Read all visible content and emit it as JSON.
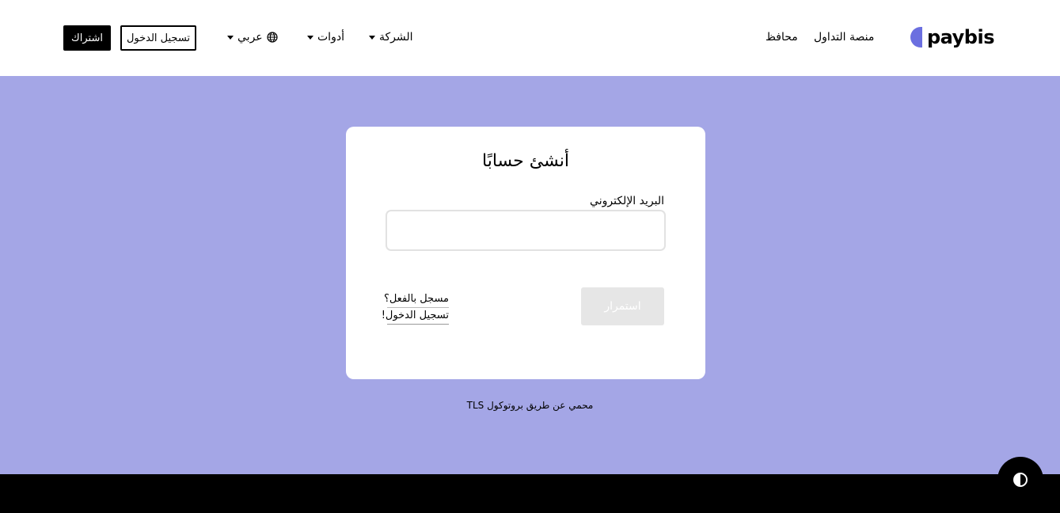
{
  "header": {
    "logo_text": "paybis",
    "nav": {
      "trading_platform": "منصة التداول",
      "wallets": "محافظ",
      "company": "الشركة",
      "tools": "أدوات",
      "language": "عربي"
    },
    "login_label": "تسجيل الدخول",
    "signup_label": "اشتراك"
  },
  "form": {
    "title": "أنشئ حسابًا",
    "email_label": "البريد الإلكتروني",
    "email_value": "",
    "continue_label": "استمرار",
    "already_registered": "مسجل بالفعل؟",
    "login_link": "تسجيل الدخول!"
  },
  "tls_note": "محمي عن طريق بروتوكول TLS",
  "colors": {
    "accent": "#6b6fe0",
    "background": "#a4a6e6",
    "button_disabled": "#e6e6e6",
    "footer": "#000000"
  },
  "icons": {
    "globe": "globe-icon",
    "caret": "caret-down-icon",
    "theme": "theme-toggle-icon"
  }
}
